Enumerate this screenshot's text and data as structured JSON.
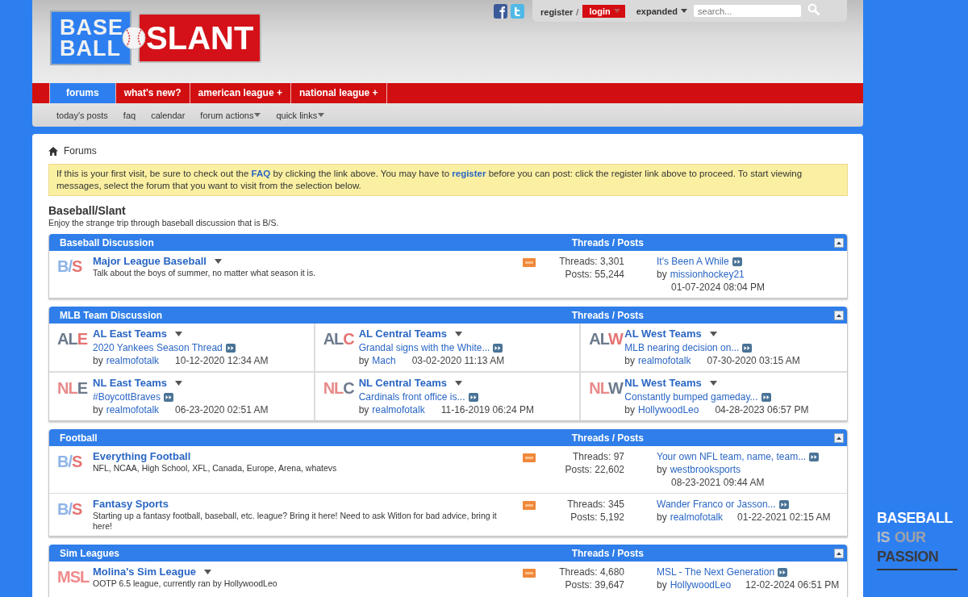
{
  "header": {
    "logo": {
      "left_lines": [
        "BASE",
        "BALL"
      ],
      "right": "SLANT"
    },
    "user_links": {
      "register": "register",
      "separator": "/",
      "login": "login"
    },
    "view_mode": "expanded",
    "search": {
      "placeholder": "search..."
    }
  },
  "nav": {
    "tabs": [
      {
        "label": "forums",
        "selected": true
      },
      {
        "label": "what's new?",
        "selected": false
      },
      {
        "label": "american league +",
        "selected": false
      },
      {
        "label": "national league +",
        "selected": false
      }
    ],
    "subnav": [
      {
        "label": "today's posts",
        "has_menu": false
      },
      {
        "label": "faq",
        "has_menu": false
      },
      {
        "label": "calendar",
        "has_menu": false
      },
      {
        "label": "forum actions",
        "has_menu": true
      },
      {
        "label": "quick links",
        "has_menu": true
      }
    ]
  },
  "breadcrumb": "Forums",
  "notice": [
    {
      "text": "If this is your first visit, be sure to check out the ",
      "link": false
    },
    {
      "text": "FAQ",
      "link": true
    },
    {
      "text": " by clicking the link above. You may have to ",
      "link": false
    },
    {
      "text": "register",
      "link": true
    },
    {
      "text": " before you can post: click the register link above to proceed. To start viewing messages, select the forum that you want to visit from the selection below.",
      "link": false
    }
  ],
  "site": {
    "title": "Baseball/Slant",
    "description": "Enjoy the strange trip through baseball discussion that is B/S."
  },
  "categories": [
    {
      "title": "Baseball Discussion",
      "stats_label": "Threads / Posts",
      "kind": "list",
      "forums": [
        {
          "icon": [
            {
              "text": "B/",
              "color": "#8fb4e8"
            },
            {
              "text": "S",
              "color": "#e57373"
            }
          ],
          "title": "Major League Baseball",
          "has_menu": true,
          "description": "Talk about the boys of summer, no matter what season it is.",
          "threads": "Threads: 3,301",
          "posts": "Posts: 55,244",
          "last_post": {
            "title": "It's Been A While",
            "by": "by",
            "user": "missionhockey21",
            "date": "01-07-2024 08:04 PM"
          }
        }
      ]
    },
    {
      "title": "MLB Team Discussion",
      "stats_label": "Threads / Posts",
      "kind": "grid",
      "forums": [
        {
          "icon": [
            {
              "text": "AL",
              "color": "#6d7b8d"
            },
            {
              "text": "E",
              "color": "#e57373"
            }
          ],
          "title": "AL East Teams",
          "has_menu": true,
          "last_post": {
            "title": "2020 Yankees Season Thread",
            "by": "by",
            "user": "realmofotalk",
            "date": "10-12-2020 12:34 AM"
          }
        },
        {
          "icon": [
            {
              "text": "AL",
              "color": "#6d7b8d"
            },
            {
              "text": "C",
              "color": "#e57373"
            }
          ],
          "title": "AL Central Teams",
          "has_menu": true,
          "last_post": {
            "title": "Grandal signs with the White...",
            "by": "by",
            "user": "Mach",
            "date": "03-02-2020 11:13 AM"
          }
        },
        {
          "icon": [
            {
              "text": "AL",
              "color": "#6d7b8d"
            },
            {
              "text": "W",
              "color": "#e57373"
            }
          ],
          "title": "AL West Teams",
          "has_menu": true,
          "last_post": {
            "title": "MLB nearing decision on...",
            "by": "by",
            "user": "realmofotalk",
            "date": "07-30-2020 03:15 AM"
          }
        },
        {
          "icon": [
            {
              "text": "NL",
              "color": "#e88a8a"
            },
            {
              "text": "E",
              "color": "#6d7b8d"
            }
          ],
          "title": "NL East Teams",
          "has_menu": true,
          "last_post": {
            "title": "#BoycottBraves",
            "by": "by",
            "user": "realmofotalk",
            "date": "06-23-2020 02:51 AM"
          }
        },
        {
          "icon": [
            {
              "text": "NL",
              "color": "#e88a8a"
            },
            {
              "text": "C",
              "color": "#6d7b8d"
            }
          ],
          "title": "NL Central Teams",
          "has_menu": true,
          "last_post": {
            "title": "Cardinals front office is...",
            "by": "by",
            "user": "realmofotalk",
            "date": "11-16-2019 06:24 PM"
          }
        },
        {
          "icon": [
            {
              "text": "NL",
              "color": "#e88a8a"
            },
            {
              "text": "W",
              "color": "#6d7b8d"
            }
          ],
          "title": "NL West Teams",
          "has_menu": true,
          "last_post": {
            "title": "Constantly bumped gameday...",
            "by": "by",
            "user": "HollywoodLeo",
            "date": "04-28-2023 06:57 PM"
          }
        }
      ]
    },
    {
      "title": "Football",
      "stats_label": "Threads / Posts",
      "kind": "list",
      "forums": [
        {
          "icon": [
            {
              "text": "B/",
              "color": "#8fb4e8"
            },
            {
              "text": "S",
              "color": "#e57373"
            }
          ],
          "title": "Everything Football",
          "has_menu": false,
          "description": "NFL, NCAA, High School, XFL, Canada, Europe, Arena, whatevs",
          "threads": "Threads: 97",
          "posts": "Posts: 22,602",
          "last_post": {
            "title": "Your own NFL team, name, team...",
            "by": "by",
            "user": "westbrooksports",
            "date": "08-23-2021 09:44 AM"
          }
        },
        {
          "icon": [
            {
              "text": "B/",
              "color": "#8fb4e8"
            },
            {
              "text": "S",
              "color": "#e57373"
            }
          ],
          "title": "Fantasy Sports",
          "has_menu": false,
          "description": "Starting up a fantasy football, baseball, etc. league? Bring it here! Need to ask Witlon for bad advice, bring it here!",
          "threads": "Threads: 345",
          "posts": "Posts: 5,192",
          "last_post": {
            "title": "Wander Franco or Jasson...",
            "by": "by",
            "user": "realmofotalk",
            "date": "01-22-2021 02:15 AM"
          }
        }
      ]
    },
    {
      "title": "Sim Leagues",
      "stats_label": "Threads / Posts",
      "kind": "list",
      "forums": [
        {
          "icon": [
            {
              "text": "MSL",
              "color": "#f08a8a"
            }
          ],
          "title": "Molina's Sim League",
          "has_menu": true,
          "description": "OOTP 6.5 league, currently ran by HollywoodLeo",
          "threads": "Threads: 4,680",
          "posts": "Posts: 39,647",
          "last_post": {
            "title": "MSL - The Next Generation",
            "by": "by",
            "user": "HollywoodLeo",
            "date": "12-02-2024 06:51 PM"
          }
        }
      ]
    }
  ],
  "side_banner": {
    "lines": [
      [
        {
          "text": "BASEBALL",
          "color": "#ffffff"
        }
      ],
      [
        {
          "text": "IS",
          "color": "#b9bcc2"
        },
        {
          "text": "OUR",
          "color": "#9fa2a8"
        }
      ],
      [
        {
          "text": "PASSION",
          "color": "#3a3b40"
        }
      ]
    ]
  }
}
